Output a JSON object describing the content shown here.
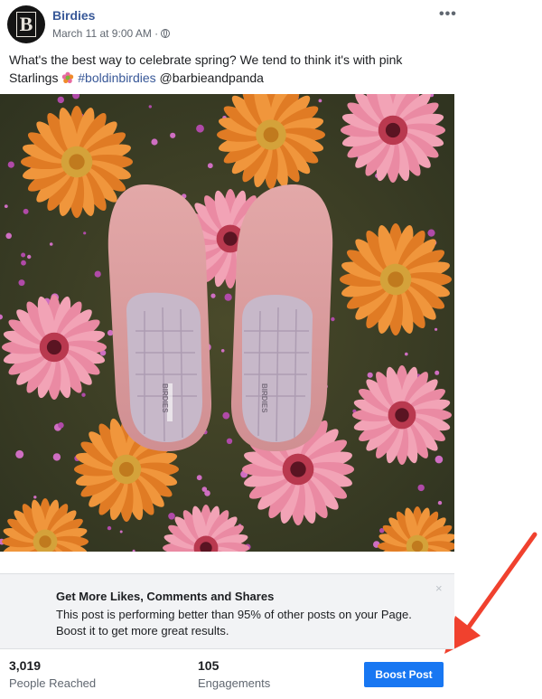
{
  "post": {
    "page_name": "Birdies",
    "avatar_monogram": "B",
    "timestamp": "March 11 at 9:00 AM ·",
    "privacy_icon": "globe-icon",
    "more_icon": "more-options-icon",
    "more_glyph": "•••",
    "text_part1": "What's the best way to celebrate spring? We tend to think it's with pink Starlings",
    "text_hashtag": "#boldinbirdies",
    "text_mention": "@barbieandpanda",
    "image_brand_text": "BIRDIES"
  },
  "promo": {
    "title": "Get More Likes, Comments and Shares",
    "body": "This post is performing better than 95% of other posts on your Page. Boost it to get more great results.",
    "close_glyph": "×"
  },
  "stats": {
    "reached_value": "3,019",
    "reached_label": "People Reached",
    "engagements_value": "105",
    "engagements_label": "Engagements",
    "boost_label": "Boost Post"
  },
  "colors": {
    "link_blue": "#385898",
    "boost_blue": "#1877f2",
    "arrow_red": "#f0412e"
  }
}
